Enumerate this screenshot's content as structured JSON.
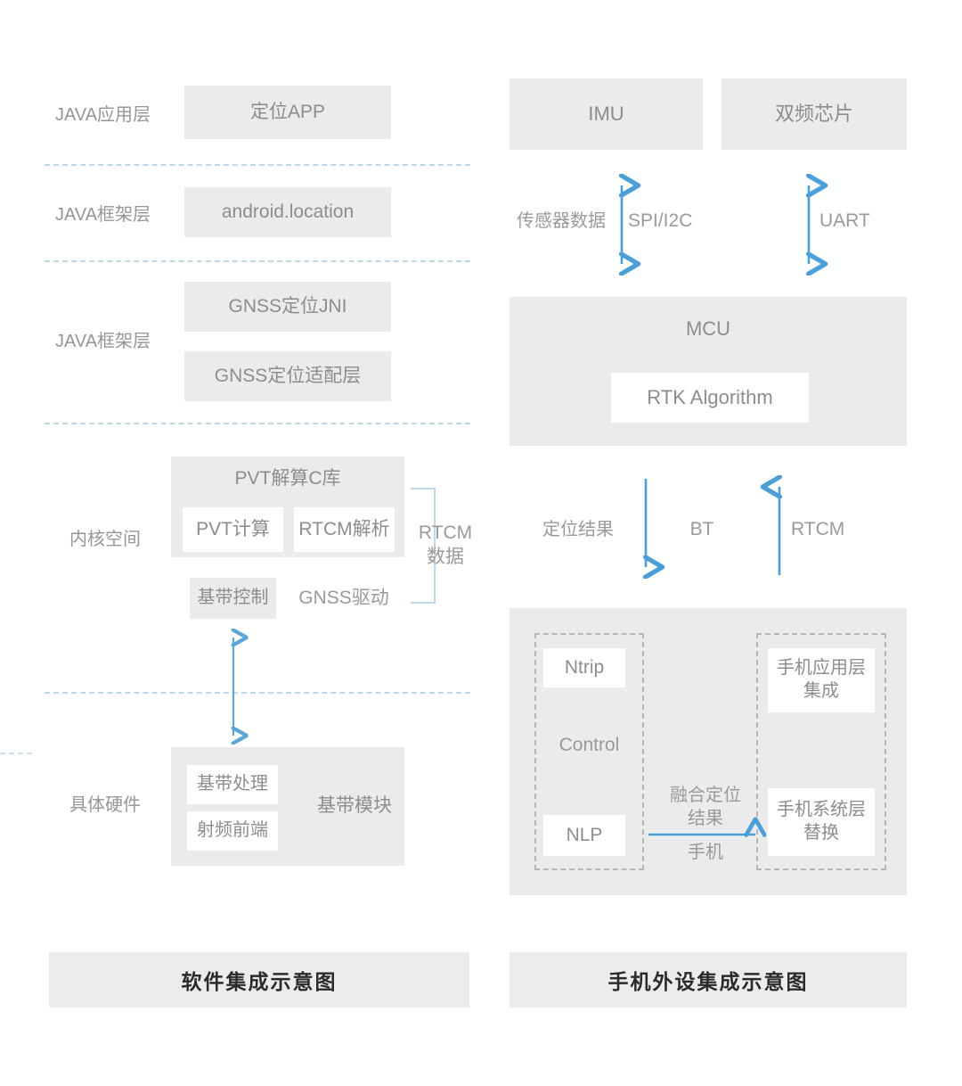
{
  "diagram": {
    "left_panel": {
      "caption": "软件集成示意图",
      "layer_labels": [
        {
          "id": "java-app-layer",
          "text": "JAVA应用层"
        },
        {
          "id": "java-framework-layer-1",
          "text": "JAVA框架层"
        },
        {
          "id": "java-framework-layer-2",
          "text": "JAVA框架层"
        },
        {
          "id": "kernel-space",
          "text": "内核空间"
        },
        {
          "id": "concrete-hardware",
          "text": "具体硬件"
        }
      ],
      "boxes": {
        "locating_app": "定位APP",
        "android_location": "android.location",
        "gnss_jni": "GNSS定位JNI",
        "gnss_adaptation": "GNSS定位适配层",
        "pvt_c_library": "PVT解算C库",
        "pvt_calc": "PVT计算",
        "rtcm_parse": "RTCM解析",
        "baseband_control": "基带控制",
        "gnss_driver": "GNSS驱动",
        "baseband_module": "基带模块",
        "baseband_process": "基带处理",
        "rf_frontend": "射频前端"
      },
      "bracket_label_line1": "RTCM",
      "bracket_label_line2": "数据"
    },
    "right_panel": {
      "caption": "手机外设集成示意图",
      "boxes": {
        "imu": "IMU",
        "dual_freq_chip": "双频芯片",
        "mcu": "MCU",
        "rtk_algorithm": "RTK Algorithm",
        "ntrip": "Ntrip",
        "control": "Control",
        "nlp": "NLP",
        "phone_app_layer_integration": "手机应用层\n集成",
        "phone_system_layer_replace": "手机系统层\n替换"
      },
      "connections": {
        "sensor_data": "传感器数据",
        "spi_i2c": "SPI/I2C",
        "uart": "UART",
        "position_result": "定位结果",
        "bt": "BT",
        "rtcm": "RTCM",
        "fusion_line1": "融合定位",
        "fusion_line2": "结果",
        "fusion_line3": "手机"
      }
    },
    "colors": {
      "box_fill": "#ebebeb",
      "inner_box_fill": "#ffffff",
      "text_gray": "#8d8d8f",
      "arrow_blue": "#4a9fd8",
      "dash_blue": "#bcd7e8",
      "dash_gray": "#b6b6b6",
      "caption_fill": "#ececec",
      "caption_text": "#2b2b2b"
    }
  }
}
